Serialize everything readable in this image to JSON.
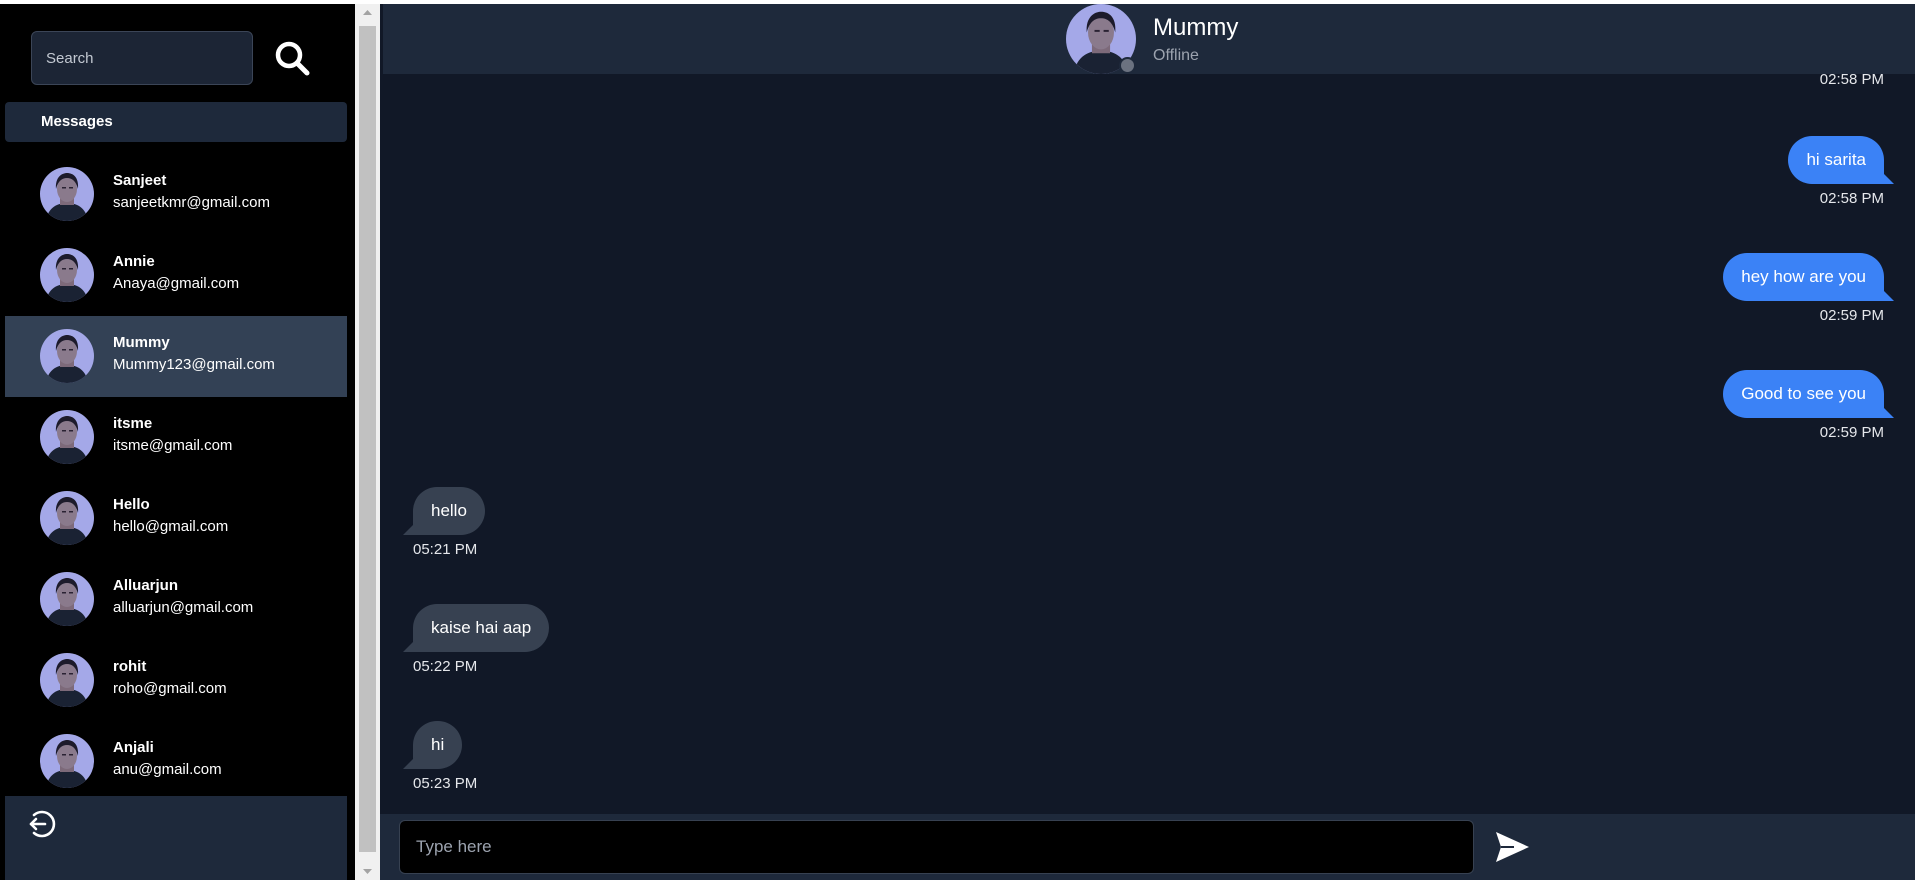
{
  "colors": {
    "accent": "#3b82f6",
    "incoming_bubble": "#374151",
    "sidebar_bg": "#000000",
    "panel_bg": "#1e293b",
    "chat_bg": "#111827",
    "offline_dot": "#6b7280"
  },
  "sidebar": {
    "search_placeholder": "Search",
    "search_icon": "search-icon",
    "messages_heading": "Messages",
    "contacts": [
      {
        "name": "Sanjeet",
        "email": "sanjeetkmr@gmail.com"
      },
      {
        "name": "Annie",
        "email": "Anaya@gmail.com"
      },
      {
        "name": "Mummy",
        "email": "Mummy123@gmail.com"
      },
      {
        "name": "itsme",
        "email": "itsme@gmail.com"
      },
      {
        "name": "Hello",
        "email": "hello@gmail.com"
      },
      {
        "name": "Alluarjun",
        "email": "alluarjun@gmail.com"
      },
      {
        "name": "rohit",
        "email": "roho@gmail.com"
      },
      {
        "name": "Anjali",
        "email": "anu@gmail.com"
      }
    ],
    "active_contact": "Mummy",
    "logout_icon": "logout-icon"
  },
  "chat": {
    "header": {
      "name": "Mummy",
      "status": "Offline"
    },
    "partial_top_time": "02:58 PM",
    "messages": [
      {
        "direction": "out",
        "text": "hi sarita",
        "time": "02:58 PM"
      },
      {
        "direction": "out",
        "text": "hey how are you",
        "time": "02:59 PM"
      },
      {
        "direction": "out",
        "text": "Good to see you",
        "time": "02:59 PM"
      },
      {
        "direction": "in",
        "text": "hello",
        "time": "05:21 PM"
      },
      {
        "direction": "in",
        "text": "kaise hai aap",
        "time": "05:22 PM"
      },
      {
        "direction": "in",
        "text": "hi",
        "time": "05:23 PM"
      }
    ],
    "composer": {
      "placeholder": "Type here",
      "send_icon": "send-icon"
    }
  }
}
